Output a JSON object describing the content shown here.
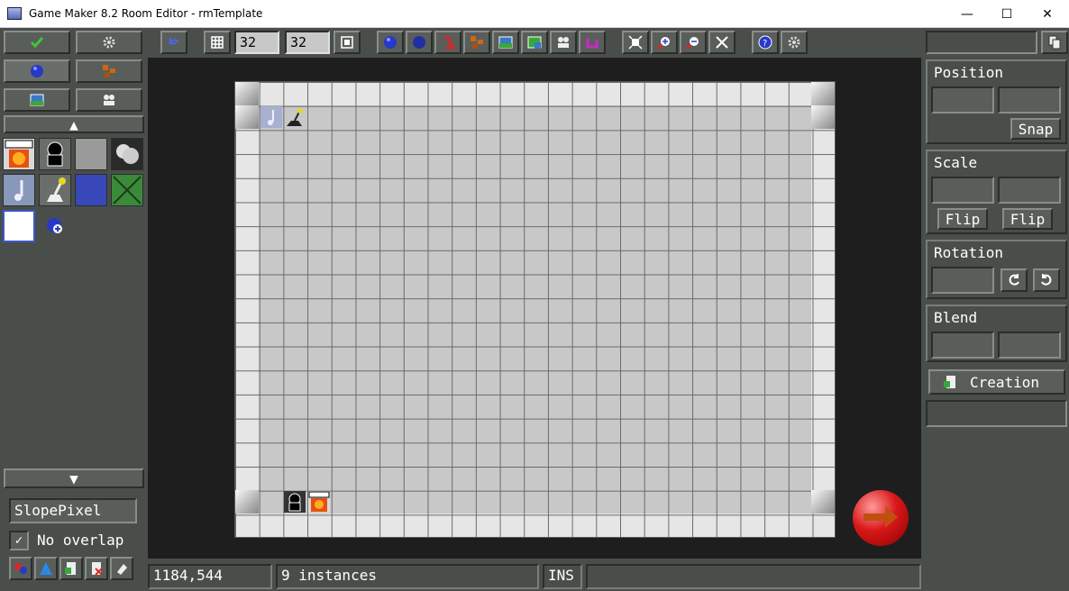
{
  "window": {
    "title": "Game Maker 8.2 Room Editor - rmTemplate",
    "minimize": "—",
    "maximize": "☐",
    "close": "✕"
  },
  "toolbar": {
    "snap_x": "32",
    "snap_y": "32"
  },
  "left_panel": {
    "up_arrow": "▲",
    "down_arrow": "▼",
    "selected_object": "SlopePixel",
    "no_overlap_label": "No overlap",
    "no_overlap_checked": "✓",
    "palette": [
      {
        "icon": "save-object-icon"
      },
      {
        "icon": "player-silhouette-icon"
      },
      {
        "icon": "gray-block-icon"
      },
      {
        "icon": "smoke-icon"
      },
      {
        "icon": "music-note-icon"
      },
      {
        "icon": "lever-icon"
      },
      {
        "icon": "blue-block-icon"
      },
      {
        "icon": "green-x-icon"
      },
      {
        "icon": "white-block-icon"
      },
      {
        "icon": "add-object-icon"
      }
    ]
  },
  "right_panel": {
    "position_label": "Position",
    "snap_label": "Snap",
    "scale_label": "Scale",
    "flip_x_label": "Flip",
    "flip_y_label": "Flip",
    "rotation_label": "Rotation",
    "blend_label": "Blend",
    "creation_label": "Creation"
  },
  "status": {
    "coords": "1184,544",
    "instances": "9 instances",
    "mode": "INS",
    "extra": ""
  },
  "colors": {
    "panel": "#4a4e4a",
    "room_bg": "#e6e6e6",
    "accent_green": "#3a9a3a"
  }
}
